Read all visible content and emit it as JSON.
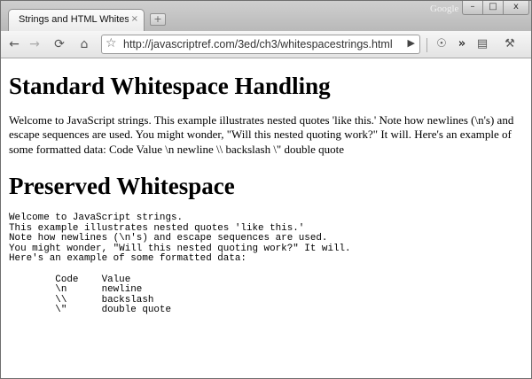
{
  "tab": {
    "title": "Strings and HTML Whites...",
    "close": "×"
  },
  "window": {
    "brand": "Google",
    "min": "–",
    "max": "□",
    "close": "x"
  },
  "toolbar": {
    "url": "http://javascriptref.com/3ed/ch3/whitespacestrings.html",
    "back_icon": "←",
    "forward_icon": "→",
    "reload_icon": "⟳",
    "home_icon": "⌂",
    "star_icon": "☆",
    "go_icon": "▶",
    "extension_icon": "☉",
    "overflow_icon": "»",
    "page_icon": "▤",
    "wrench_icon": "⚒"
  },
  "page": {
    "heading1": "Standard Whitespace Handling",
    "paragraph": "Welcome to JavaScript strings. This example illustrates nested quotes 'like this.' Note how newlines (\\n's) and escape sequences are used. You might wonder, \"Will this nested quoting work?\" It will. Here's an example of some formatted data: Code Value \\n newline \\\\ backslash \\\" double quote",
    "heading2": "Preserved Whitespace",
    "preformatted": "Welcome to JavaScript strings.\nThis example illustrates nested quotes 'like this.'\nNote how newlines (\\n's) and escape sequences are used.\nYou might wonder, \"Will this nested quoting work?\" It will.\nHere's an example of some formatted data:\n\n        Code    Value\n        \\n      newline\n        \\\\      backslash\n        \\\"      double quote"
  }
}
